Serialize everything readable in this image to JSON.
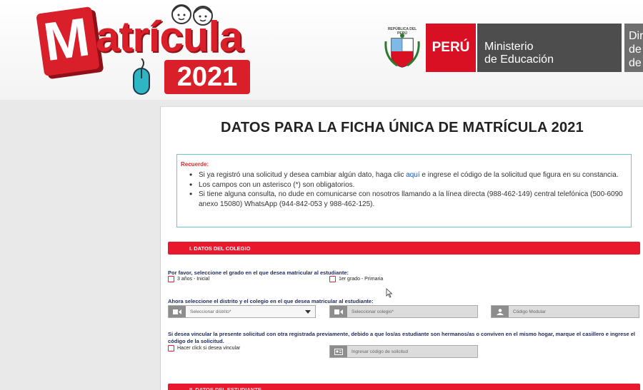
{
  "header": {
    "logo_first_letter": "M",
    "logo_rest": "atrícula",
    "logo_year": "2021",
    "escudo_text": "REPÚBLICA DEL PERÚ",
    "peru_label": "PERÚ",
    "ministry_line1": "Ministerio",
    "ministry_line2": "de Educación",
    "direction_lines": [
      "Dir",
      "de",
      "de"
    ]
  },
  "form": {
    "title": "DATOS PARA LA FICHA ÚNICA DE MATRÍCULA 2021",
    "notice": {
      "heading": "Recuerde:",
      "item1_before": "Si ya registró una solicitud y desea cambiar algún dato, haga clic ",
      "item1_link": "aquí",
      "item1_after": " e ingrese el código de la solicitud que figura en su constancia.",
      "item2": "Los campos con un asterisco (*) son obligatorios.",
      "item3": "Si tiene alguna consulta, no dude en comunicarse con nosotros llamando a la línea directa (988-462-149) central telefónica (500-6090 anexo 15080) WhatsApp (944-842-053 y 988-462-125)."
    },
    "section1": {
      "title": "I. DATOS DEL COLEGIO",
      "grade_question": "Por favor, seleccione el grado en el que desea matricular al estudiante:",
      "grade_options": [
        "3 años - Inicial",
        "1er grado - Primaria"
      ],
      "school_question": "Ahora seleccione el distrito y el colegio en el que desea matricular al estudiante:",
      "district_placeholder": "Seleccionar distrito*",
      "school_placeholder": "Seleccionar colegio*",
      "modular_placeholder": "Código Modular",
      "link_question": "Si desea vincular la presente solicitud con otra registrada previamente, debido a que los/as estudiante son hermanos/as o conviven en el mismo hogar, marque el casillero e ingrese el código de la solicitud.",
      "link_checkbox_label": "Hacer click si desea vincular",
      "request_code_placeholder": "Ingresar código de solicitud"
    },
    "section2": {
      "title": "II. DATOS DEL ESTUDIANTE"
    }
  },
  "colors": {
    "brand_red": "#e8192c",
    "ministry_gray": "#4d4d4d",
    "notice_border": "#6ec6cc",
    "label_blue": "#1f2a5c",
    "link_blue": "#1a57c4"
  }
}
